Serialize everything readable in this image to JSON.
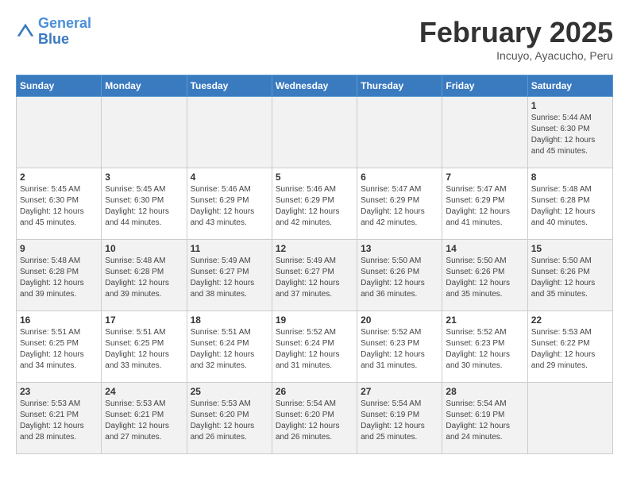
{
  "header": {
    "logo_line1": "General",
    "logo_line2": "Blue",
    "month_title": "February 2025",
    "subtitle": "Incuyo, Ayacucho, Peru"
  },
  "days_of_week": [
    "Sunday",
    "Monday",
    "Tuesday",
    "Wednesday",
    "Thursday",
    "Friday",
    "Saturday"
  ],
  "weeks": [
    [
      {
        "day": "",
        "info": ""
      },
      {
        "day": "",
        "info": ""
      },
      {
        "day": "",
        "info": ""
      },
      {
        "day": "",
        "info": ""
      },
      {
        "day": "",
        "info": ""
      },
      {
        "day": "",
        "info": ""
      },
      {
        "day": "1",
        "info": "Sunrise: 5:44 AM\nSunset: 6:30 PM\nDaylight: 12 hours\nand 45 minutes."
      }
    ],
    [
      {
        "day": "2",
        "info": "Sunrise: 5:45 AM\nSunset: 6:30 PM\nDaylight: 12 hours\nand 45 minutes."
      },
      {
        "day": "3",
        "info": "Sunrise: 5:45 AM\nSunset: 6:30 PM\nDaylight: 12 hours\nand 44 minutes."
      },
      {
        "day": "4",
        "info": "Sunrise: 5:46 AM\nSunset: 6:29 PM\nDaylight: 12 hours\nand 43 minutes."
      },
      {
        "day": "5",
        "info": "Sunrise: 5:46 AM\nSunset: 6:29 PM\nDaylight: 12 hours\nand 42 minutes."
      },
      {
        "day": "6",
        "info": "Sunrise: 5:47 AM\nSunset: 6:29 PM\nDaylight: 12 hours\nand 42 minutes."
      },
      {
        "day": "7",
        "info": "Sunrise: 5:47 AM\nSunset: 6:29 PM\nDaylight: 12 hours\nand 41 minutes."
      },
      {
        "day": "8",
        "info": "Sunrise: 5:48 AM\nSunset: 6:28 PM\nDaylight: 12 hours\nand 40 minutes."
      }
    ],
    [
      {
        "day": "9",
        "info": "Sunrise: 5:48 AM\nSunset: 6:28 PM\nDaylight: 12 hours\nand 39 minutes."
      },
      {
        "day": "10",
        "info": "Sunrise: 5:48 AM\nSunset: 6:28 PM\nDaylight: 12 hours\nand 39 minutes."
      },
      {
        "day": "11",
        "info": "Sunrise: 5:49 AM\nSunset: 6:27 PM\nDaylight: 12 hours\nand 38 minutes."
      },
      {
        "day": "12",
        "info": "Sunrise: 5:49 AM\nSunset: 6:27 PM\nDaylight: 12 hours\nand 37 minutes."
      },
      {
        "day": "13",
        "info": "Sunrise: 5:50 AM\nSunset: 6:26 PM\nDaylight: 12 hours\nand 36 minutes."
      },
      {
        "day": "14",
        "info": "Sunrise: 5:50 AM\nSunset: 6:26 PM\nDaylight: 12 hours\nand 35 minutes."
      },
      {
        "day": "15",
        "info": "Sunrise: 5:50 AM\nSunset: 6:26 PM\nDaylight: 12 hours\nand 35 minutes."
      }
    ],
    [
      {
        "day": "16",
        "info": "Sunrise: 5:51 AM\nSunset: 6:25 PM\nDaylight: 12 hours\nand 34 minutes."
      },
      {
        "day": "17",
        "info": "Sunrise: 5:51 AM\nSunset: 6:25 PM\nDaylight: 12 hours\nand 33 minutes."
      },
      {
        "day": "18",
        "info": "Sunrise: 5:51 AM\nSunset: 6:24 PM\nDaylight: 12 hours\nand 32 minutes."
      },
      {
        "day": "19",
        "info": "Sunrise: 5:52 AM\nSunset: 6:24 PM\nDaylight: 12 hours\nand 31 minutes."
      },
      {
        "day": "20",
        "info": "Sunrise: 5:52 AM\nSunset: 6:23 PM\nDaylight: 12 hours\nand 31 minutes."
      },
      {
        "day": "21",
        "info": "Sunrise: 5:52 AM\nSunset: 6:23 PM\nDaylight: 12 hours\nand 30 minutes."
      },
      {
        "day": "22",
        "info": "Sunrise: 5:53 AM\nSunset: 6:22 PM\nDaylight: 12 hours\nand 29 minutes."
      }
    ],
    [
      {
        "day": "23",
        "info": "Sunrise: 5:53 AM\nSunset: 6:21 PM\nDaylight: 12 hours\nand 28 minutes."
      },
      {
        "day": "24",
        "info": "Sunrise: 5:53 AM\nSunset: 6:21 PM\nDaylight: 12 hours\nand 27 minutes."
      },
      {
        "day": "25",
        "info": "Sunrise: 5:53 AM\nSunset: 6:20 PM\nDaylight: 12 hours\nand 26 minutes."
      },
      {
        "day": "26",
        "info": "Sunrise: 5:54 AM\nSunset: 6:20 PM\nDaylight: 12 hours\nand 26 minutes."
      },
      {
        "day": "27",
        "info": "Sunrise: 5:54 AM\nSunset: 6:19 PM\nDaylight: 12 hours\nand 25 minutes."
      },
      {
        "day": "28",
        "info": "Sunrise: 5:54 AM\nSunset: 6:19 PM\nDaylight: 12 hours\nand 24 minutes."
      },
      {
        "day": "",
        "info": ""
      }
    ]
  ]
}
